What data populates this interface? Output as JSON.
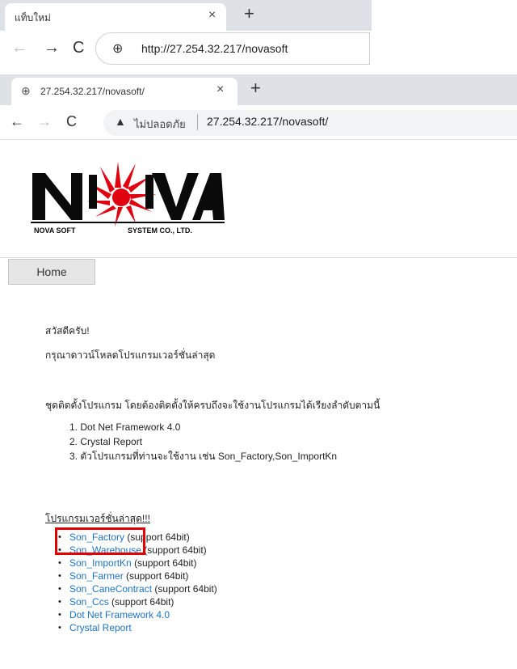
{
  "browser1": {
    "tab_title": "แท็บใหม่",
    "tab_close": "×",
    "new_tab": "+",
    "back": "←",
    "forward": "→",
    "reload": "C",
    "site_icon": "⊕",
    "url": "http://27.254.32.217/novasoft"
  },
  "browser2": {
    "tab_icon": "⊕",
    "tab_title": "27.254.32.217/novasoft/",
    "tab_close": "×",
    "new_tab": "+",
    "back": "←",
    "forward": "→",
    "reload": "C",
    "warn_icon": "▲",
    "insecure_label": "ไม่ปลอดภัย",
    "url": "27.254.32.217/novasoft/"
  },
  "logo": {
    "text_left": "NOVA SOFT",
    "text_right": "SYSTEM CO., LTD.",
    "colors": {
      "letters": "#0a0a0a",
      "burst": "#e00010"
    }
  },
  "nav": {
    "home_label": "Home"
  },
  "page": {
    "greeting": "สวัสดีครับ!",
    "download_prompt": "กรุณาดาวน์โหลดโปรแกรมเวอร์ชั่นล่าสุด",
    "install_heading": "ชุดติดตั้งโปรแกรม โดยต้องติดตั้งให้ครบถึงจะใช้งานโปรแกรมได้เรียงลำดับตามนี้",
    "install_steps": [
      "1. Dot Net Framework 4.0",
      "2. Crystal Report",
      "3. ตัวโปรแกรมที่ท่านจะใช้งาน เช่น Son_Factory,Son_ImportKn"
    ],
    "latest_heading": "โปรแกรมเวอร์ชั่นล่าสุด!!!",
    "downloads": [
      {
        "name": "Son_Factory",
        "note": "(support 64bit)"
      },
      {
        "name": "Son_Warehouse",
        "note": "(support 64bit)"
      },
      {
        "name": "Son_ImportKn",
        "note": "(support 64bit)"
      },
      {
        "name": "Son_Farmer",
        "note": "(support 64bit)"
      },
      {
        "name": "Son_CaneContract",
        "note": "(support 64bit)"
      },
      {
        "name": "Son_Ccs",
        "note": "(support 64bit)"
      },
      {
        "name": "Dot Net Framework 4.0",
        "note": ""
      },
      {
        "name": "Crystal Report",
        "note": ""
      }
    ],
    "bullet": "•",
    "link_color": "#1f73c2",
    "highlight_color": "#e00000"
  }
}
